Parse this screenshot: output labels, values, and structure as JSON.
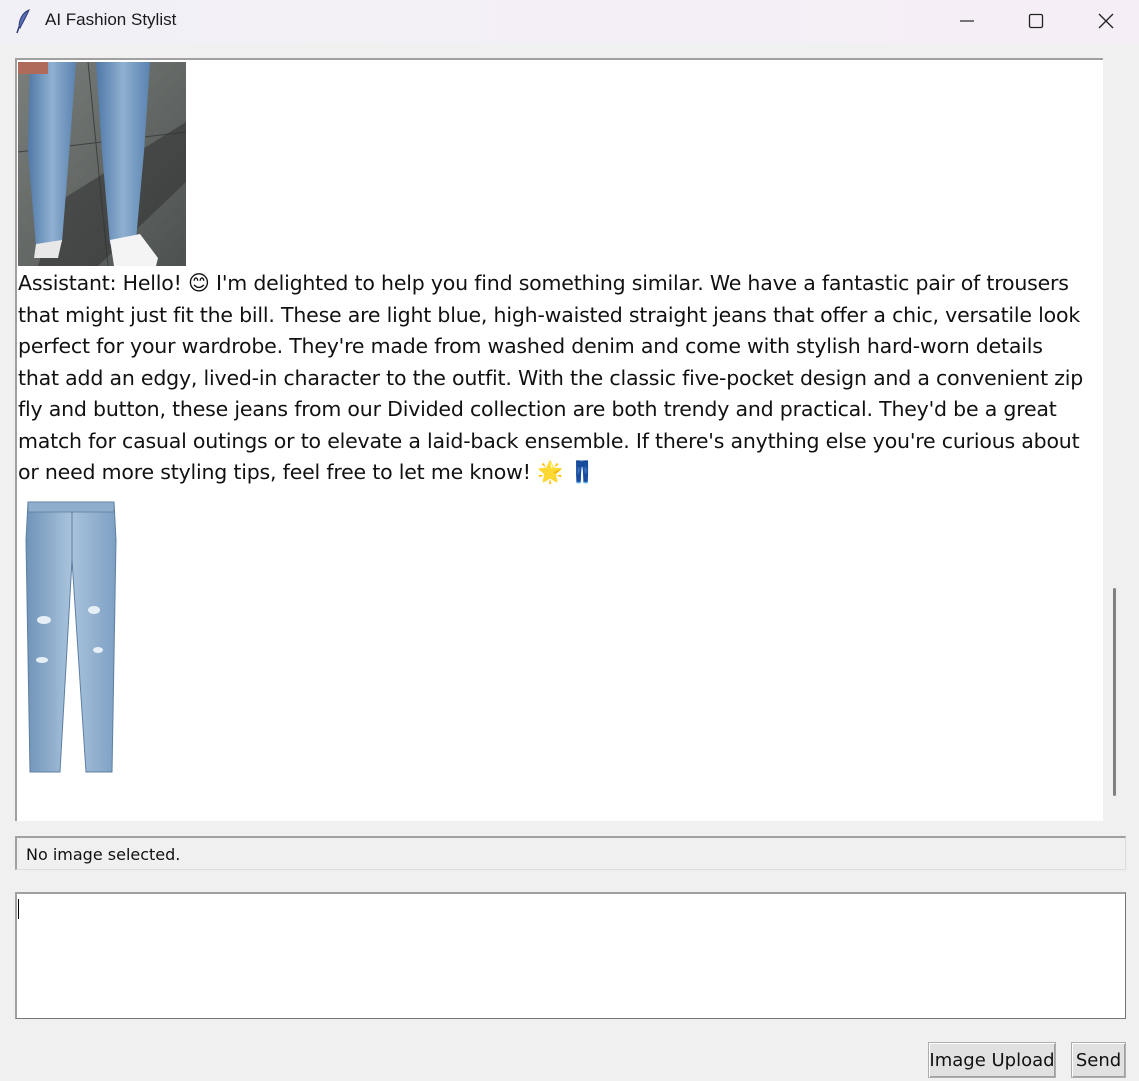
{
  "window": {
    "title": "AI Fashion Stylist",
    "app_icon": "feather-icon",
    "controls": {
      "minimize": "minimize-icon",
      "maximize": "maximize-icon",
      "close": "close-icon"
    }
  },
  "chat": {
    "messages": [
      {
        "type": "image",
        "icon": "user-uploaded-photo"
      },
      {
        "type": "text",
        "speaker": "Assistant:",
        "text_part1": "Hello!",
        "emoji1": "😊",
        "text_part2": "I'm delighted to help you find something similar. We have a fantastic pair of trousers that might just fit the bill. These are light blue, high-waisted straight jeans that offer a chic, versatile look perfect for your wardrobe. They're made from washed denim and come with stylish hard-worn details that add an edgy, lived-in character to the outfit. With the classic five-pocket design and a convenient zip fly and button, these jeans from our Divided collection are both trendy and practical. They'd be a great match for casual outings or to elevate a laid-back ensemble. If there's anything else you're curious about or need more styling tips, feel free to let me know!",
        "emoji2": "🌟",
        "emoji3": "👖"
      },
      {
        "type": "image",
        "icon": "product-jeans-photo"
      }
    ]
  },
  "status": {
    "text": "No image selected."
  },
  "input": {
    "value": "",
    "placeholder": ""
  },
  "buttons": {
    "upload_label": "Image Upload",
    "send_label": "Send"
  },
  "colors": {
    "window_bg": "#f0f0f0",
    "chat_bg": "#ffffff",
    "border": "#a0a0a0",
    "button_bg": "#e1e1e1"
  }
}
